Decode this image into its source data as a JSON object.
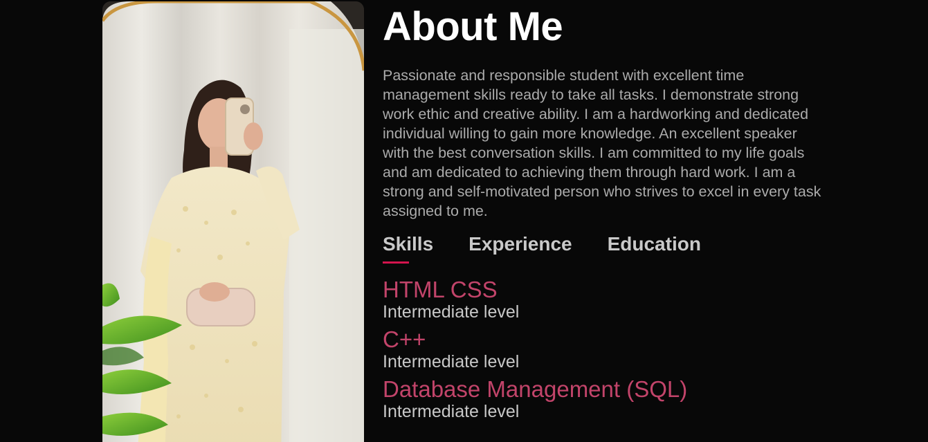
{
  "about": {
    "title": "About Me",
    "bio": "Passionate and responsible student with excellent time management skills ready to take all tasks. I demonstrate strong work ethic and creative ability. I am a hardworking and dedicated individual willing to gain more knowledge. An excellent speaker with the best conversation skills. I am committed to my life goals and am dedicated to achieving them through hard work. I am a strong and self-motivated person who strives to excel in every task assigned to me."
  },
  "tabs": [
    {
      "label": "Skills",
      "active": true
    },
    {
      "label": "Experience",
      "active": false
    },
    {
      "label": "Education",
      "active": false
    }
  ],
  "skills": [
    {
      "name": "HTML CSS",
      "level": "Intermediate level"
    },
    {
      "name": "C++",
      "level": "Intermediate level"
    },
    {
      "name": "Database Management (SQL)",
      "level": "Intermediate level"
    }
  ],
  "colors": {
    "background": "#080808",
    "accent": "#d4144d",
    "skill_name": "#c2446a",
    "heading": "#ffffff",
    "body_text": "#ababab"
  }
}
